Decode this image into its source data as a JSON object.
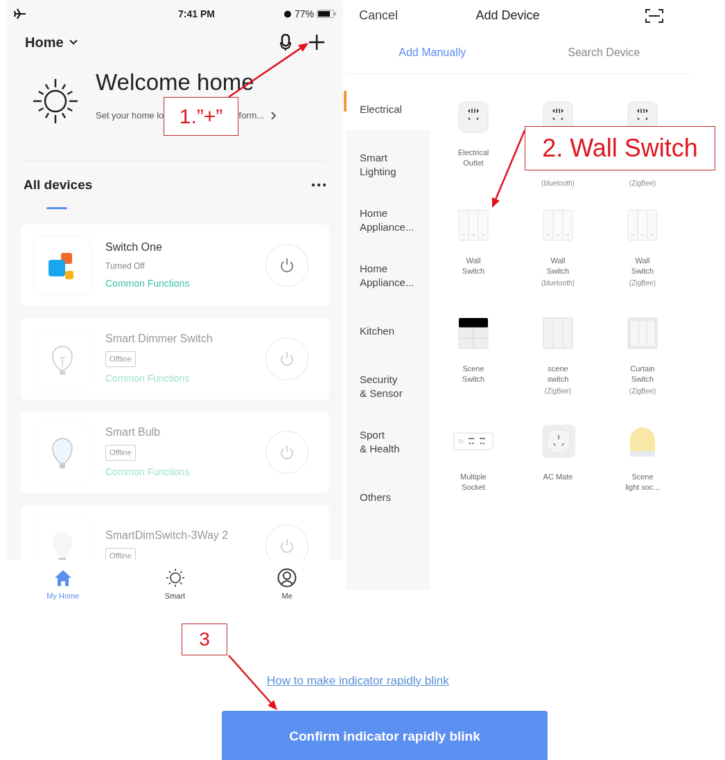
{
  "home_screen": {
    "status_bar": {
      "time": "7:41 PM",
      "battery": "77%"
    },
    "home_selector": "Home",
    "welcome": {
      "title": "Welcome home",
      "subtitle_start": "Set your home lo",
      "subtitle_end": "form..."
    },
    "section_title": "All devices",
    "devices": [
      {
        "name": "Switch One",
        "status": "Turned Off",
        "kind": "online",
        "functions": "Common Functions"
      },
      {
        "name": "Smart Dimmer Switch",
        "status": "Offline",
        "kind": "offline",
        "functions": "Common Functions"
      },
      {
        "name": "Smart Bulb",
        "status": "Offline",
        "kind": "offline",
        "functions": "Common Functions"
      },
      {
        "name": "SmartDimSwitch-3Way 2",
        "status": "Offline",
        "kind": "offline"
      }
    ],
    "tab_bar": [
      {
        "label": "My Home",
        "selected": true
      },
      {
        "label": "Smart",
        "selected": false
      },
      {
        "label": "Me",
        "selected": false
      }
    ]
  },
  "add_device": {
    "cancel": "Cancel",
    "title": "Add Device",
    "tabs": [
      {
        "label": "Add Manually",
        "selected": true
      },
      {
        "label": "Search Device",
        "selected": false
      }
    ],
    "categories": [
      {
        "label": "Electrical",
        "selected": true
      },
      {
        "label": "Smart\nLighting",
        "selected": false
      },
      {
        "label": "Home\nAppliance...",
        "selected": false
      },
      {
        "label": "Home\nAppliance...",
        "selected": false
      },
      {
        "label": "Kitchen",
        "selected": false
      },
      {
        "label": "Security\n& Sensor",
        "selected": false
      },
      {
        "label": "Sport\n& Health",
        "selected": false
      },
      {
        "label": "Others",
        "selected": false
      }
    ],
    "products": [
      {
        "name": "Electrical\nOutlet"
      },
      {
        "sub": "(bluetooth)"
      },
      {
        "sub": "(ZigBee)"
      },
      {
        "name": "Wall\nSwitch"
      },
      {
        "name": "Wall\nSwitch",
        "sub": "(bluetooth)"
      },
      {
        "name": "Wall\nSwitch",
        "sub": "(ZigBee)"
      },
      {
        "name": "Scene\nSwitch"
      },
      {
        "name": "scene\nswitch",
        "sub": "(ZigBee)"
      },
      {
        "name": "Curtain\nSwitch",
        "sub": "(ZigBee)"
      },
      {
        "name": "Multiple\nSocket"
      },
      {
        "name": "AC Mate"
      },
      {
        "name": "Scene\nlight soc..."
      }
    ]
  },
  "pairing": {
    "help_link": "How to make indicator rapidly blink",
    "confirm_button": "Confirm indicator rapidly blink"
  },
  "annotations": [
    {
      "label": "1.”+”"
    },
    {
      "label": "2. Wall Switch"
    },
    {
      "label": "3"
    }
  ]
}
